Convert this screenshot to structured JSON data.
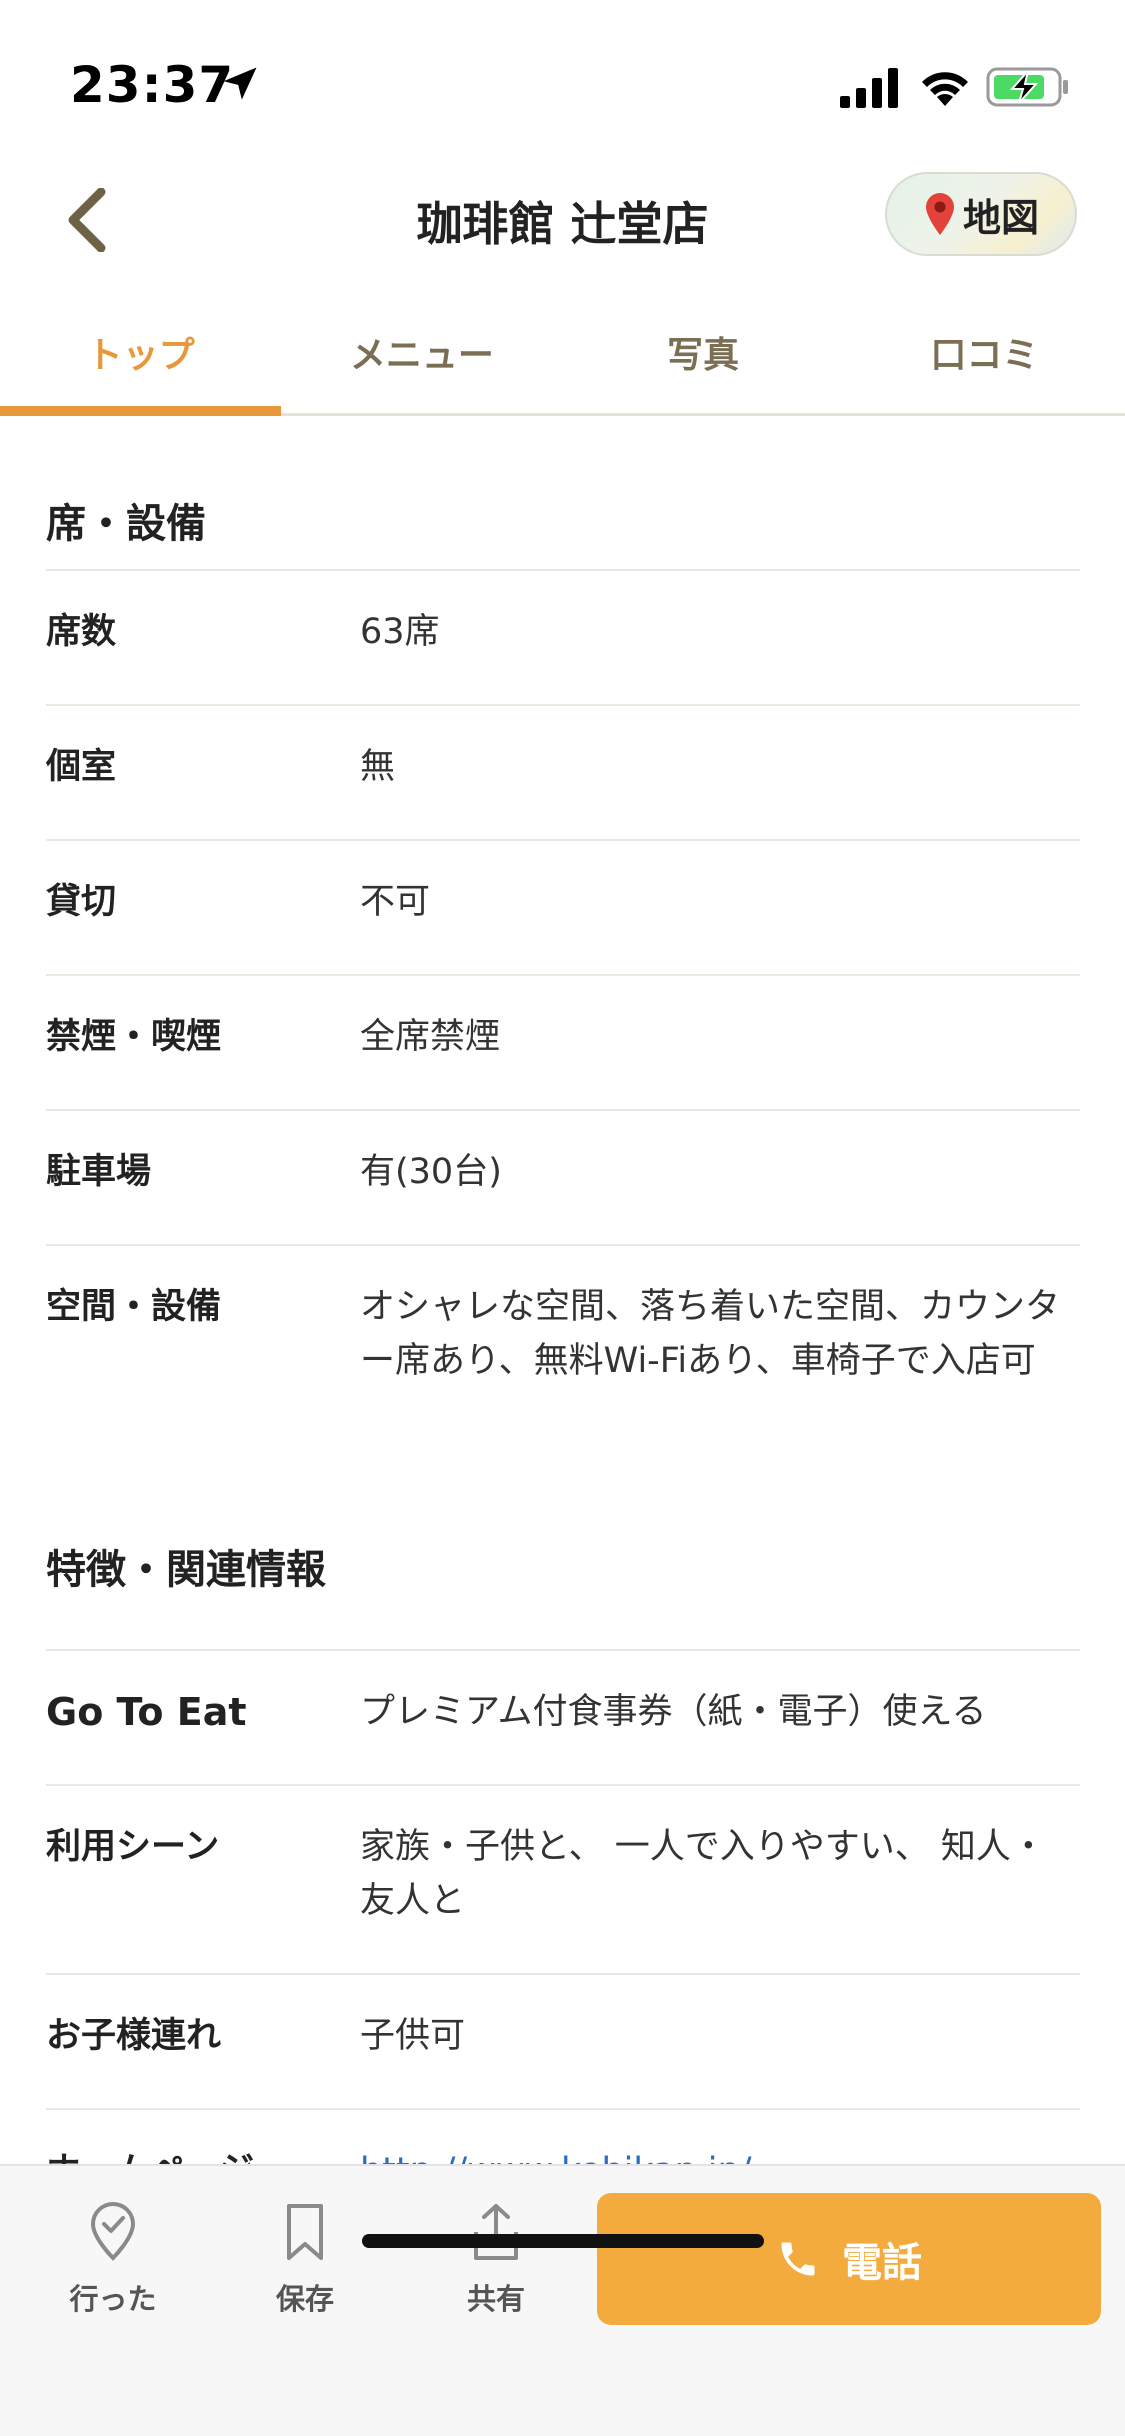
{
  "status_bar": {
    "time": "23:37"
  },
  "nav": {
    "title": "珈琲館 辻堂店",
    "map_label": "地図"
  },
  "tabs": [
    {
      "label": "トップ",
      "active": true
    },
    {
      "label": "メニュー",
      "active": false
    },
    {
      "label": "写真",
      "active": false
    },
    {
      "label": "口コミ",
      "active": false
    }
  ],
  "sections": [
    {
      "title": "席・設備",
      "rows": [
        {
          "label": "席数",
          "value": "63席"
        },
        {
          "label": "個室",
          "value": "無"
        },
        {
          "label": "貸切",
          "value": "不可"
        },
        {
          "label": "禁煙・喫煙",
          "value": "全席禁煙"
        },
        {
          "label": "駐車場",
          "value": "有(30台)"
        },
        {
          "label": "空間・設備",
          "value": "オシャレな空間、落ち着いた空間、カウンター席あり、無料Wi-Fiあり、車椅子で入店可"
        }
      ]
    },
    {
      "title": "特徴・関連情報",
      "rows": [
        {
          "label": "Go To Eat",
          "value": "プレミアム付食事券（紙・電子）使える"
        },
        {
          "label": "利用シーン",
          "value": "家族・子供と、 一人で入りやすい、 知人・友人と"
        },
        {
          "label": "お子様連れ",
          "value": "子供可"
        },
        {
          "label": "ホームページ",
          "value": "http://www.kohikan.jp/"
        }
      ]
    }
  ],
  "bottom_bar": {
    "went_label": "行った",
    "save_label": "保存",
    "share_label": "共有",
    "call_label": "電話"
  },
  "colors": {
    "accent": "#e8973a",
    "call_button": "#f2ab3c",
    "link": "#2a6bc4",
    "tab_text": "#7a6f55"
  }
}
